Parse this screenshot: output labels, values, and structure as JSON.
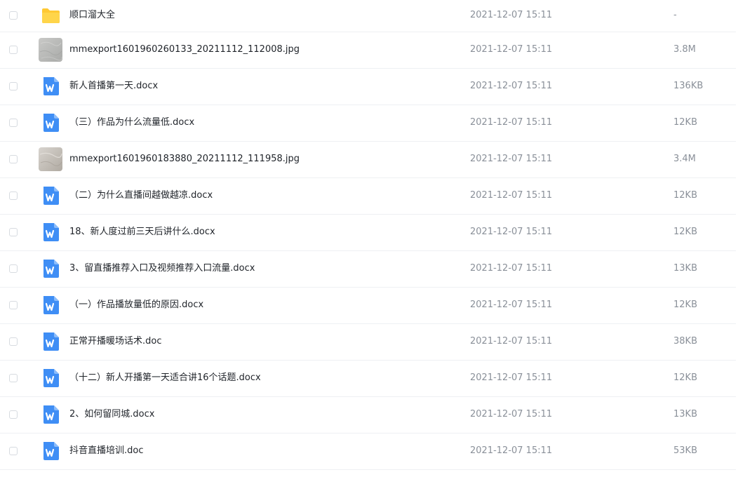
{
  "files": [
    {
      "name": "顺口溜大全",
      "date": "2021-12-07 15:11",
      "size": "-",
      "icon": "folder-icon",
      "type": "folder"
    },
    {
      "name": "mmexport1601960260133_20211112_112008.jpg",
      "date": "2021-12-07 15:11",
      "size": "3.8M",
      "icon": "image-thumbnail-icon",
      "type": "image"
    },
    {
      "name": "新人首播第一天.docx",
      "date": "2021-12-07 15:11",
      "size": "136KB",
      "icon": "word-doc-icon",
      "type": "doc"
    },
    {
      "name": "（三）作品为什么流量低.docx",
      "date": "2021-12-07 15:11",
      "size": "12KB",
      "icon": "word-doc-icon",
      "type": "doc"
    },
    {
      "name": "mmexport1601960183880_20211112_111958.jpg",
      "date": "2021-12-07 15:11",
      "size": "3.4M",
      "icon": "image-thumbnail-icon",
      "type": "image"
    },
    {
      "name": "（二）为什么直播间越做越凉.docx",
      "date": "2021-12-07 15:11",
      "size": "12KB",
      "icon": "word-doc-icon",
      "type": "doc"
    },
    {
      "name": "18、新人度过前三天后讲什么.docx",
      "date": "2021-12-07 15:11",
      "size": "12KB",
      "icon": "word-doc-icon",
      "type": "doc"
    },
    {
      "name": "3、留直播推荐入口及视频推荐入口流量.docx",
      "date": "2021-12-07 15:11",
      "size": "13KB",
      "icon": "word-doc-icon",
      "type": "doc"
    },
    {
      "name": "（一）作品播放量低的原因.docx",
      "date": "2021-12-07 15:11",
      "size": "12KB",
      "icon": "word-doc-icon",
      "type": "doc"
    },
    {
      "name": "正常开播暖场话术.doc",
      "date": "2021-12-07 15:11",
      "size": "38KB",
      "icon": "word-doc-icon",
      "type": "doc"
    },
    {
      "name": "（十二）新人开播第一天适合讲16个话题.docx",
      "date": "2021-12-07 15:11",
      "size": "12KB",
      "icon": "word-doc-icon",
      "type": "doc"
    },
    {
      "name": "2、如何留同城.docx",
      "date": "2021-12-07 15:11",
      "size": "13KB",
      "icon": "word-doc-icon",
      "type": "doc"
    },
    {
      "name": "抖音直播培训.doc",
      "date": "2021-12-07 15:11",
      "size": "53KB",
      "icon": "word-doc-icon",
      "type": "doc"
    }
  ],
  "colors": {
    "folder": "#ffc933",
    "doc": "#3f8ef5",
    "text": "#1f2329",
    "muted": "#8a9099",
    "divider": "#eef0f3"
  }
}
